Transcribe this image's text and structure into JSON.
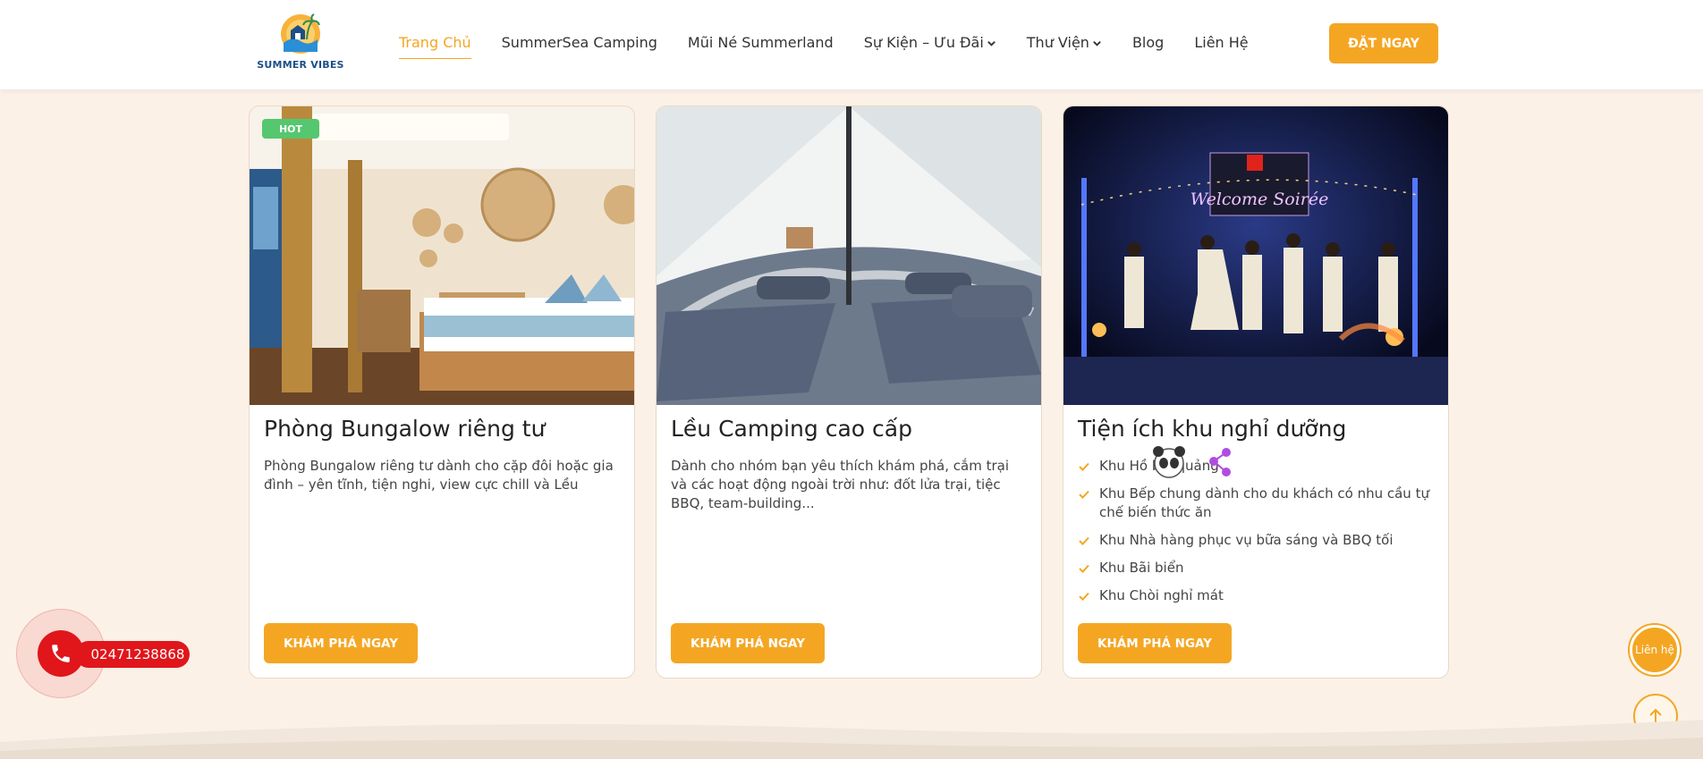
{
  "brand": {
    "name": "SUMMER VIBES",
    "accent": "#f4a623",
    "accent_dark": "#1d4f86"
  },
  "nav": {
    "items": [
      {
        "label": "Trang Chủ",
        "active": true,
        "dropdown": false
      },
      {
        "label": "SummerSea Camping",
        "active": false,
        "dropdown": false
      },
      {
        "label": "Mũi Né Summerland",
        "active": false,
        "dropdown": false
      },
      {
        "label": "Sự Kiện – Ưu Đãi",
        "active": false,
        "dropdown": true
      },
      {
        "label": "Thư Viện",
        "active": false,
        "dropdown": true
      },
      {
        "label": "Blog",
        "active": false,
        "dropdown": false
      },
      {
        "label": "Liên Hệ",
        "active": false,
        "dropdown": false
      }
    ],
    "cta": "ĐẶT NGAY"
  },
  "cards": [
    {
      "badge": "HOT",
      "title": "Phòng Bungalow riêng tư",
      "desc": "Phòng Bungalow riêng tư dành cho cặp đôi hoặc gia đình – yên tĩnh, tiện nghi, view cực chill và Lều",
      "button": "KHÁM PHÁ NGAY"
    },
    {
      "title": "Lều Camping cao cấp",
      "desc": "Dành cho nhóm bạn yêu thích khám phá, cắm trại và các hoạt động ngoài trời như: đốt lửa trại, tiệc BBQ, team-building...",
      "button": "KHÁM PHÁ NGAY"
    },
    {
      "title": "Tiện ích khu nghỉ dưỡng",
      "features": [
        "Khu Hồ bơi quảng",
        "Khu Bếp chung dành cho du khách có nhu cầu tự chế biến thức ăn",
        "Khu Nhà hàng phục vụ bữa sáng và BBQ tối",
        "Khu Bãi biển",
        "Khu Chòi nghỉ mát"
      ],
      "button": "KHÁM PHÁ NGAY"
    }
  ],
  "floating": {
    "phone": "02471238868",
    "contact": "Liên hệ",
    "scroll_top_icon": "arrow-up-icon"
  },
  "sign_text": "Welcome Soirée"
}
